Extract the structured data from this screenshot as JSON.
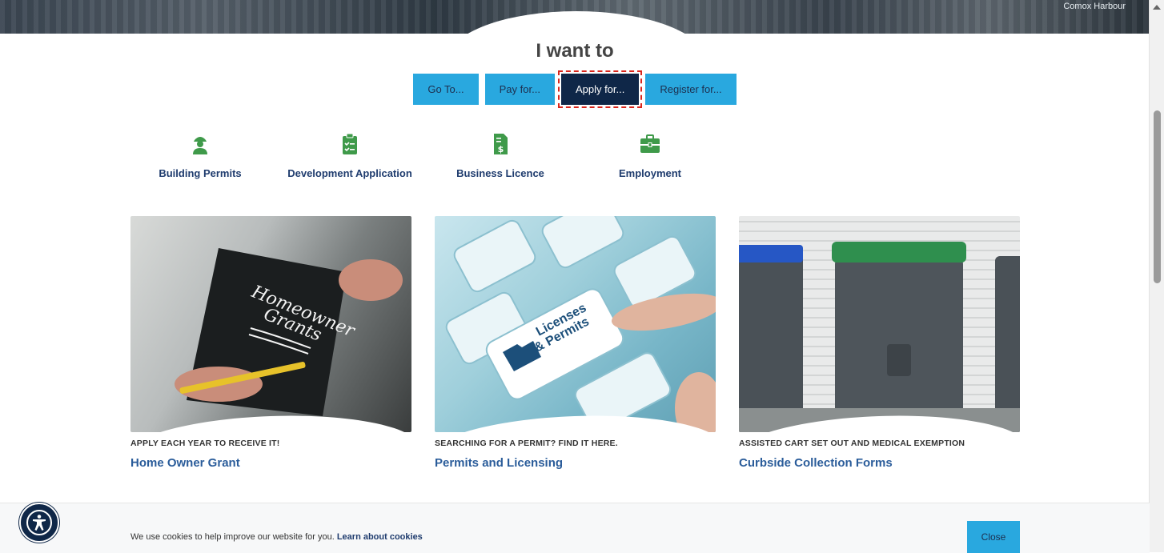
{
  "hero": {
    "caption": "Comox Harbour"
  },
  "i_want": {
    "title": "I want to"
  },
  "tabs": [
    {
      "label": "Go To..."
    },
    {
      "label": "Pay for..."
    },
    {
      "label": "Apply for..."
    },
    {
      "label": "Register for..."
    }
  ],
  "quick_links": [
    {
      "label": "Building Permits",
      "icon": "worker-icon"
    },
    {
      "label": "Development Application",
      "icon": "clipboard-icon"
    },
    {
      "label": "Business Licence",
      "icon": "invoice-dollar-icon"
    },
    {
      "label": "Employment",
      "icon": "briefcase-icon"
    }
  ],
  "cards": [
    {
      "kicker": "APPLY EACH YEAR TO RECEIVE IT!",
      "title": "Home Owner Grant",
      "image_text": [
        "Homeowner",
        "Grants"
      ]
    },
    {
      "kicker": "SEARCHING FOR A PERMIT? FIND IT HERE.",
      "title": "Permits and Licensing",
      "image_text": [
        "Licenses",
        "& Permits"
      ]
    },
    {
      "kicker": "ASSISTED CART SET OUT AND MEDICAL EXEMPTION",
      "title": "Curbside Collection Forms"
    }
  ],
  "cookie": {
    "text": "We use cookies to help improve our website for you.",
    "link": "Learn about cookies",
    "close": "Close"
  },
  "colors": {
    "accent_blue": "#29a8df",
    "navy": "#0f2748",
    "icon_green": "#3f9a4a",
    "link_blue": "#2a5c9a"
  }
}
